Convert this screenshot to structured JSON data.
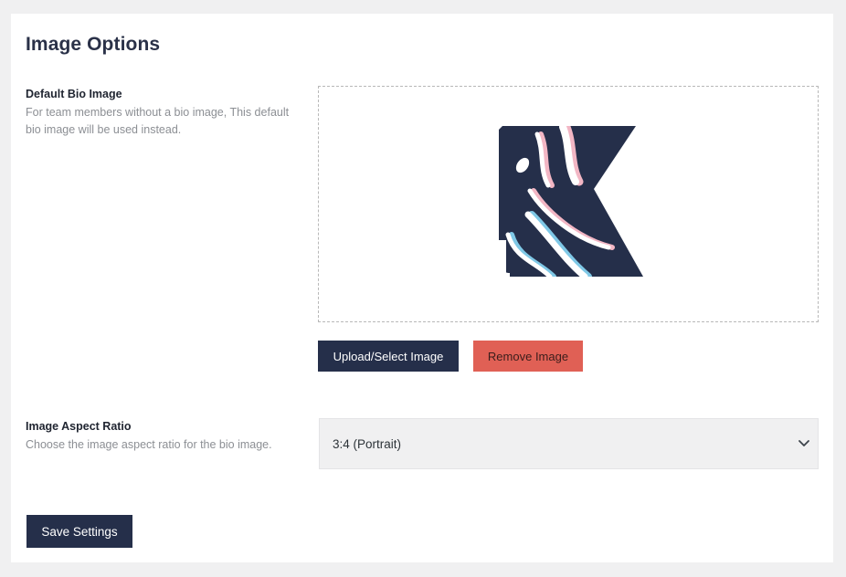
{
  "page": {
    "title": "Image Options"
  },
  "bio_image": {
    "label": "Default Bio Image",
    "description": "For team members without a bio image, This default bio image will be used instead.",
    "upload_button": "Upload/Select Image",
    "remove_button": "Remove Image",
    "preview_icon": "stylized-k-logo"
  },
  "aspect_ratio": {
    "label": "Image Aspect Ratio",
    "description": "Choose the image aspect ratio for the bio image.",
    "selected": "3:4 (Portrait)",
    "chevron_icon": "chevron-down-icon"
  },
  "actions": {
    "save_label": "Save Settings"
  },
  "colors": {
    "page_bg": "#f0f0f1",
    "panel_bg": "#ffffff",
    "primary_button": "#252f4a",
    "danger_button": "#e06055",
    "heading": "#2a3148",
    "muted_text": "#8c8f94"
  }
}
